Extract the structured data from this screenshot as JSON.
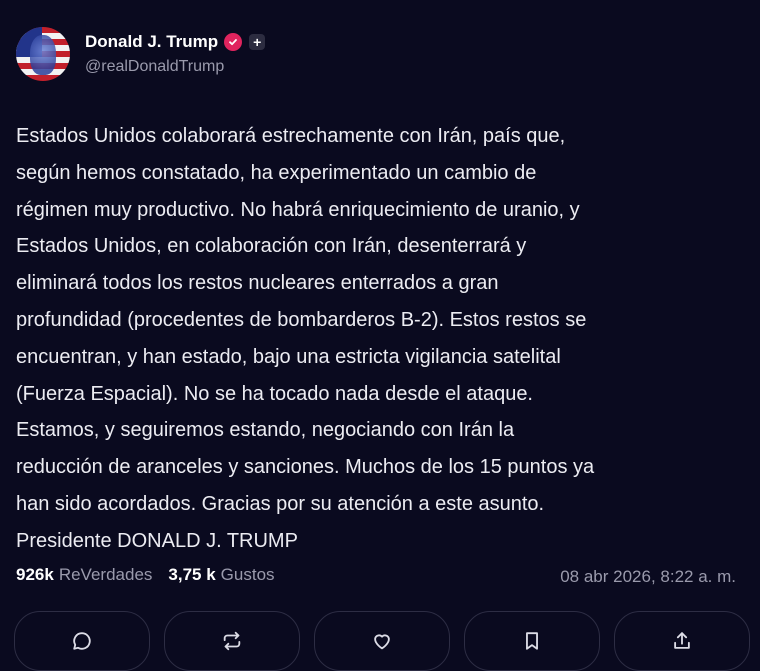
{
  "author": {
    "display_name": "Donald J. Trump",
    "handle": "@realDonaldTrump",
    "plus_badge": "+",
    "verified_color": "#e0245e"
  },
  "post": {
    "text": "Estados Unidos colaborará estrechamente con Irán, país que,\nsegún hemos constatado, ha experimentado un cambio de\nrégimen muy productivo. No habrá enriquecimiento de uranio, y\nEstados Unidos, en colaboración con Irán, desenterrará y\neliminará todos los restos nucleares enterrados a gran\nprofundidad (procedentes de bombarderos B-2). Estos restos se\nencuentran, y han estado, bajo una estricta vigilancia satelital\n(Fuerza Espacial). No se ha tocado nada desde el ataque.\nEstamos, y seguiremos estando, negociando con Irán la\nreducción de aranceles y sanciones. Muchos de los 15 puntos ya\nhan sido acordados. Gracias por su atención a este asunto.\nPresidente DONALD J. TRUMP"
  },
  "stats": {
    "reposts_count": "926k",
    "reposts_label": "ReVerdades",
    "likes_count": "3,75 k",
    "likes_label": "Gustos"
  },
  "timestamp": "08 abr 2026, 8:22 a. m.",
  "actions": [
    {
      "icon": "reply-icon"
    },
    {
      "icon": "repost-icon"
    },
    {
      "icon": "heart-icon"
    },
    {
      "icon": "bookmark-icon"
    },
    {
      "icon": "share-icon"
    }
  ],
  "colors": {
    "background": "#0a0a1f",
    "text": "#ececf2",
    "muted": "#9a9aac",
    "border": "#2d2d44"
  }
}
